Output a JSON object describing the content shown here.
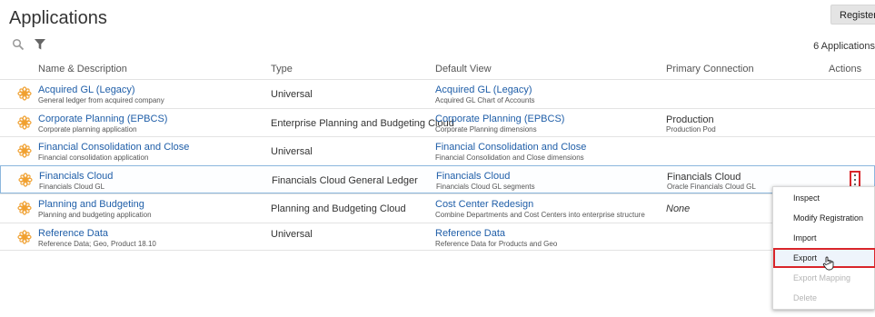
{
  "header": {
    "title": "Applications",
    "register_label": "Register",
    "count_label": "6 Applications"
  },
  "icons": {
    "search": "search-icon",
    "filter": "filter-icon",
    "app": "application-flower-icon",
    "actions": "vertical-ellipsis-icon",
    "cursor": "hand-pointer-icon"
  },
  "colors": {
    "link": "#1f5ea8",
    "app_icon": "#f0a030",
    "highlight": "#d9252a",
    "selected_border": "#8bb7dd"
  },
  "columns": {
    "name": "Name & Description",
    "type": "Type",
    "default_view": "Default View",
    "connection": "Primary Connection",
    "actions": "Actions"
  },
  "rows": [
    {
      "name": "Acquired GL (Legacy)",
      "description": "General ledger from acquired company",
      "type": "Universal",
      "view_name": "Acquired GL (Legacy)",
      "view_desc": "Acquired GL Chart of Accounts",
      "connection": "",
      "connection_desc": ""
    },
    {
      "name": "Corporate Planning (EPBCS)",
      "description": "Corporate planning application",
      "type": "Enterprise Planning and Budgeting Cloud",
      "view_name": "Corporate Planning (EPBCS)",
      "view_desc": "Corporate Planning dimensions",
      "connection": "Production",
      "connection_desc": "Production Pod"
    },
    {
      "name": "Financial Consolidation and Close",
      "description": "Financial consolidation application",
      "type": "Universal",
      "view_name": "Financial Consolidation and Close",
      "view_desc": "Financial Consolidation and Close dimensions",
      "connection": "",
      "connection_desc": ""
    },
    {
      "name": "Financials Cloud",
      "description": "Financials Cloud GL",
      "type": "Financials Cloud General Ledger",
      "view_name": "Financials Cloud",
      "view_desc": "Financials Cloud GL segments",
      "connection": "Financials Cloud",
      "connection_desc": "Oracle Financials Cloud GL"
    },
    {
      "name": "Planning and Budgeting",
      "description": "Planning and budgeting application",
      "type": "Planning and Budgeting Cloud",
      "view_name": "Cost Center Redesign",
      "view_desc": "Combine Departments and Cost Centers into enterprise structure",
      "connection": "None",
      "connection_desc": ""
    },
    {
      "name": "Reference Data",
      "description": "Reference Data; Geo, Product 18.10",
      "type": "Universal",
      "view_name": "Reference Data",
      "view_desc": "Reference Data for Products and Geo",
      "connection": "",
      "connection_desc": ""
    }
  ],
  "menu": {
    "items": [
      {
        "label": "Inspect",
        "state": "enabled"
      },
      {
        "label": "Modify Registration",
        "state": "enabled"
      },
      {
        "label": "Import",
        "state": "enabled"
      },
      {
        "label": "Export",
        "state": "hovered"
      },
      {
        "label": "Export Mapping",
        "state": "disabled"
      },
      {
        "label": "Delete",
        "state": "disabled"
      }
    ]
  }
}
